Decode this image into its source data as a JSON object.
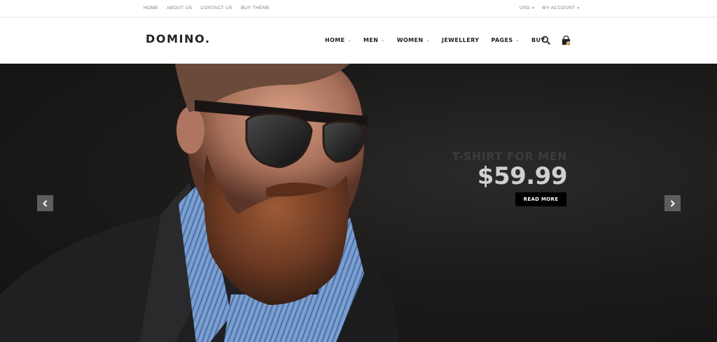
{
  "topbar": {
    "links": [
      "HOME",
      "ABOUT US",
      "CONTACT US",
      "BUY THEME"
    ],
    "currency": "USD",
    "account": "MY ACCOUNT"
  },
  "header": {
    "logo": "DOMINO.",
    "nav": [
      {
        "label": "HOME",
        "dropdown": true
      },
      {
        "label": "MEN",
        "dropdown": true
      },
      {
        "label": "WOMEN",
        "dropdown": true
      },
      {
        "label": "JEWELLERY",
        "dropdown": false
      },
      {
        "label": "PAGES",
        "dropdown": true
      },
      {
        "label": "BUY",
        "dropdown": false
      }
    ],
    "icons": [
      "search-icon",
      "shopping-bag-icon"
    ]
  },
  "hero": {
    "subtitle": "T-SHIRT FOR MEN",
    "price": "$59.99",
    "button": "READ MORE",
    "arrows": [
      "chevron-left-icon",
      "chevron-right-icon"
    ]
  },
  "colors": {
    "accent": "#000000",
    "hero_bg": "#1c1b1a",
    "price": "#d0d0d0",
    "arrow_bg": "#5e5e5e"
  }
}
